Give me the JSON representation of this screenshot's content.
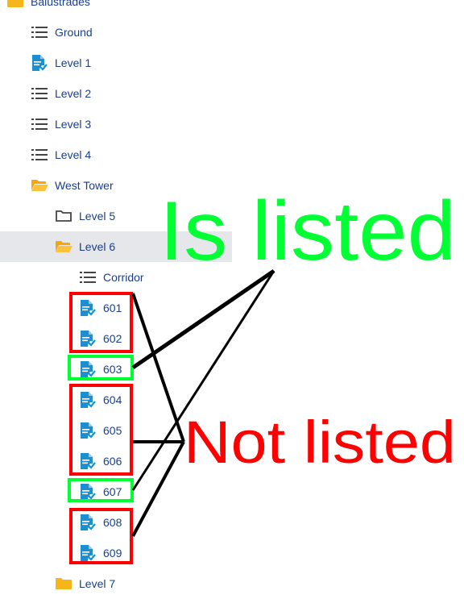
{
  "tree": [
    {
      "label": "Balustrades",
      "icon": "folder-icon",
      "depth": 0
    },
    {
      "label": "Ground",
      "icon": "list-icon",
      "depth": 1
    },
    {
      "label": "Level 1",
      "icon": "document-check-icon",
      "depth": 1
    },
    {
      "label": "Level 2",
      "icon": "list-icon",
      "depth": 1
    },
    {
      "label": "Level 3",
      "icon": "list-icon",
      "depth": 1
    },
    {
      "label": "Level 4",
      "icon": "list-icon",
      "depth": 1
    },
    {
      "label": "West Tower",
      "icon": "folder-open-icon",
      "depth": 1
    },
    {
      "label": "Level 5",
      "icon": "folder-outline-icon",
      "depth": 2
    },
    {
      "label": "Level 6",
      "icon": "folder-open-icon",
      "depth": 2,
      "selected": true
    },
    {
      "label": "Corridor",
      "icon": "list-icon",
      "depth": 3
    },
    {
      "label": "601",
      "icon": "document-check-icon",
      "depth": 3
    },
    {
      "label": "602",
      "icon": "document-check-icon",
      "depth": 3
    },
    {
      "label": "603",
      "icon": "document-check-icon",
      "depth": 3
    },
    {
      "label": "604",
      "icon": "document-check-icon",
      "depth": 3
    },
    {
      "label": "605",
      "icon": "document-check-icon",
      "depth": 3
    },
    {
      "label": "606",
      "icon": "document-check-icon",
      "depth": 3
    },
    {
      "label": "607",
      "icon": "document-check-icon",
      "depth": 3
    },
    {
      "label": "608",
      "icon": "document-check-icon",
      "depth": 3
    },
    {
      "label": "609",
      "icon": "document-check-icon",
      "depth": 3
    },
    {
      "label": "Level 7",
      "icon": "folder-icon",
      "depth": 2
    }
  ],
  "annotations": {
    "listed_text": "Is listed",
    "not_listed_text": "Not listed",
    "listed_color": "#00ff33",
    "not_listed_color": "#ff0000",
    "line_color": "#000000"
  },
  "colors": {
    "label": "#1a3f8c",
    "folder": "#f7b51c",
    "doc": "#1b8fd0",
    "selected_bg": "#e5e7eb",
    "icon_gray": "#444444"
  }
}
